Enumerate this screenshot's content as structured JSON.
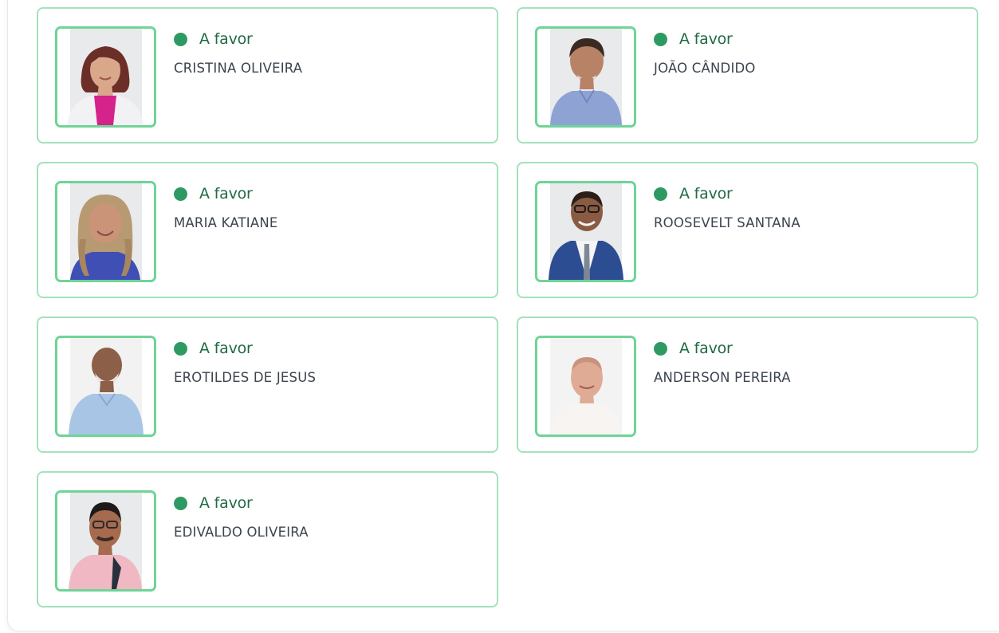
{
  "votes": [
    {
      "status_icon": "green-dot",
      "status": "A favor",
      "name": "CRISTINA OLIVEIRA",
      "photo": "councilor-photo"
    },
    {
      "status_icon": "green-dot",
      "status": "A favor",
      "name": "JOÃO CÂNDIDO",
      "photo": "councilor-photo"
    },
    {
      "status_icon": "green-dot",
      "status": "A favor",
      "name": "MARIA KATIANE",
      "photo": "councilor-photo"
    },
    {
      "status_icon": "green-dot",
      "status": "A favor",
      "name": "ROOSEVELT SANTANA",
      "photo": "councilor-photo"
    },
    {
      "status_icon": "green-dot",
      "status": "A favor",
      "name": "EROTILDES DE JESUS",
      "photo": "councilor-photo"
    },
    {
      "status_icon": "green-dot",
      "status": "A favor",
      "name": "ANDERSON PEREIRA",
      "photo": "councilor-photo"
    },
    {
      "status_icon": "green-dot",
      "status": "A favor",
      "name": "EDIVALDO OLIVEIRA",
      "photo": "councilor-photo"
    }
  ],
  "colors": {
    "card_border": "#a3e2bb",
    "photo_border": "#6fd497",
    "status_dot": "#2e9a63",
    "status_text": "#1f6b44",
    "name_text": "#3c4450"
  }
}
